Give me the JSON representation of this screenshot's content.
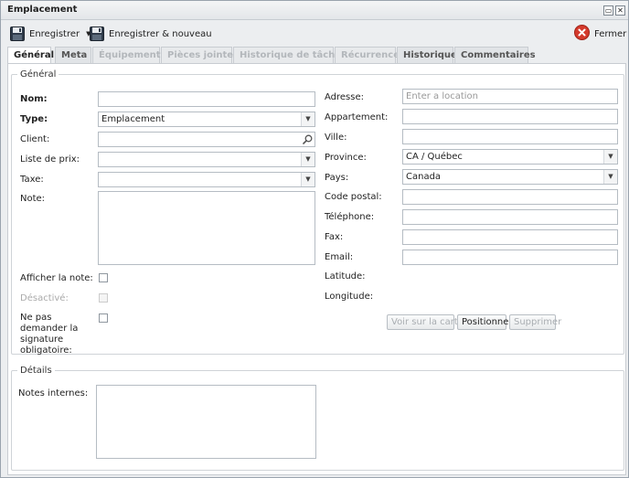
{
  "window": {
    "title": "Emplacement"
  },
  "toolbar": {
    "save_label": "Enregistrer",
    "save_new_label": "Enregistrer & nouveau",
    "close_label": "Fermer"
  },
  "tabs": [
    {
      "label": "Général",
      "state": "active"
    },
    {
      "label": "Meta",
      "state": "normal"
    },
    {
      "label": "Équipements",
      "state": "disabled"
    },
    {
      "label": "Pièces jointes",
      "state": "disabled"
    },
    {
      "label": "Historique de tâches",
      "state": "disabled"
    },
    {
      "label": "Récurrence",
      "state": "disabled"
    },
    {
      "label": "Historique",
      "state": "normal"
    },
    {
      "label": "Commentaires",
      "state": "normal"
    }
  ],
  "general": {
    "legend": "Général",
    "nom_label": "Nom:",
    "nom_value": "",
    "type_label": "Type:",
    "type_value": "Emplacement",
    "client_label": "Client:",
    "client_value": "",
    "prix_label": "Liste de prix:",
    "prix_value": "",
    "taxe_label": "Taxe:",
    "taxe_value": "",
    "note_label": "Note:",
    "afficher_note_label": "Afficher la note:",
    "desactive_label": "Désactivé:",
    "signature_label": "Ne pas demander la signature obligatoire:",
    "adresse_label": "Adresse:",
    "adresse_placeholder": "Enter a location",
    "appartement_label": "Appartement:",
    "ville_label": "Ville:",
    "province_label": "Province:",
    "province_value": "CA / Québec",
    "pays_label": "Pays:",
    "pays_value": "Canada",
    "code_postal_label": "Code postal:",
    "telephone_label": "Téléphone:",
    "fax_label": "Fax:",
    "email_label": "Email:",
    "latitude_label": "Latitude:",
    "longitude_label": "Longitude:",
    "voir_carte_label": "Voir sur la carte",
    "positionner_label": "Positionner",
    "supprimer_label": "Supprimer"
  },
  "details": {
    "legend": "Détails",
    "notes_internes_label": "Notes internes:"
  }
}
